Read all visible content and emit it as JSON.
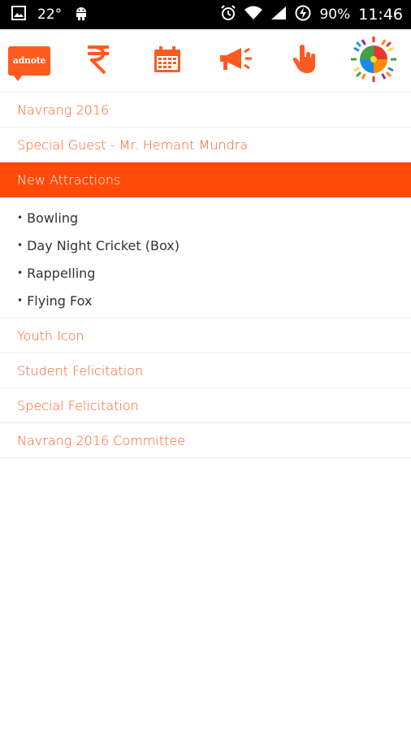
{
  "status_bar": {
    "temperature": "22°",
    "battery": "90%",
    "time": "11:46"
  },
  "toolbar": {
    "logo_text": "adnote",
    "icons": [
      "rupee-icon",
      "calendar-icon",
      "megaphone-icon",
      "hand-pointer-icon",
      "navrang-emblem-icon"
    ]
  },
  "menu": {
    "items": [
      {
        "label": "Navrang 2016"
      },
      {
        "label": "Special Guest - Mr. Hemant Mundra"
      },
      {
        "label": "New Attractions"
      },
      {
        "label": "Youth Icon"
      },
      {
        "label": "Student Felicitation"
      },
      {
        "label": "Special Felicitation"
      },
      {
        "label": "Navrang 2016 Committee"
      }
    ],
    "new_attractions_sub": [
      {
        "label": "Bowling"
      },
      {
        "label": "Day Night Cricket (Box)"
      },
      {
        "label": "Rappelling"
      },
      {
        "label": "Flying Fox"
      }
    ],
    "bullet": "•"
  },
  "colors": {
    "accent": "#ff5a1f",
    "active_bg": "#ff4a0a",
    "status_bar_bg": "#000000"
  }
}
